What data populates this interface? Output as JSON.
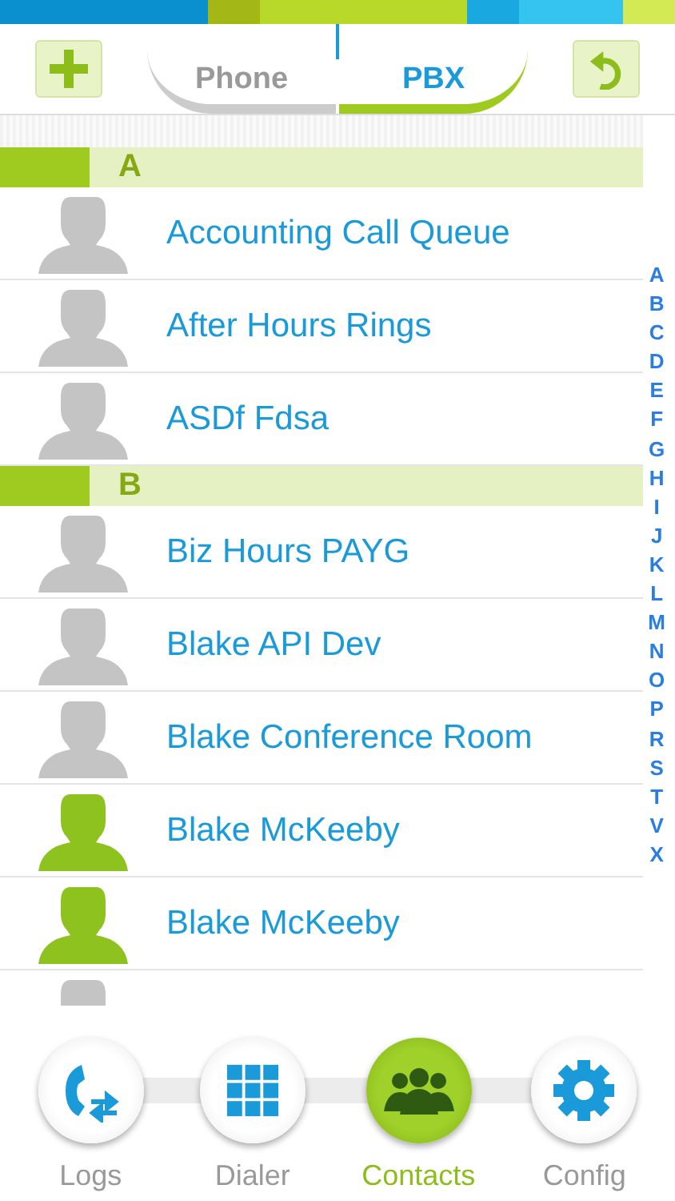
{
  "segments": [
    {
      "label": "Phone",
      "selected": false
    },
    {
      "label": "PBX",
      "selected": true
    }
  ],
  "sections": [
    {
      "letter": "A",
      "contacts": [
        {
          "name": "Accounting Call Queue",
          "color": "#c4c4c4"
        },
        {
          "name": "After Hours Rings",
          "color": "#c4c4c4"
        },
        {
          "name": "ASDf Fdsa",
          "color": "#c4c4c4"
        }
      ]
    },
    {
      "letter": "B",
      "contacts": [
        {
          "name": "Biz Hours PAYG",
          "color": "#c4c4c4"
        },
        {
          "name": "Blake API Dev",
          "color": "#c4c4c4"
        },
        {
          "name": "Blake Conference Room",
          "color": "#c4c4c4"
        },
        {
          "name": "Blake McKeeby",
          "color": "#8dc21f"
        },
        {
          "name": "Blake McKeeby",
          "color": "#8dc21f"
        },
        {
          "color": "#c4c4c4"
        }
      ]
    }
  ],
  "index": [
    "A",
    "B",
    "C",
    "D",
    "E",
    "F",
    "G",
    "H",
    "I",
    "J",
    "K",
    "L",
    "M",
    "N",
    "O",
    "P",
    "R",
    "S",
    "T",
    "V",
    "X"
  ],
  "tabs": [
    {
      "label": "Logs",
      "kind": "logs",
      "selected": false
    },
    {
      "label": "Dialer",
      "kind": "dialer",
      "selected": false
    },
    {
      "label": "Contacts",
      "kind": "contacts",
      "selected": true
    },
    {
      "label": "Config",
      "kind": "config",
      "selected": false
    }
  ]
}
